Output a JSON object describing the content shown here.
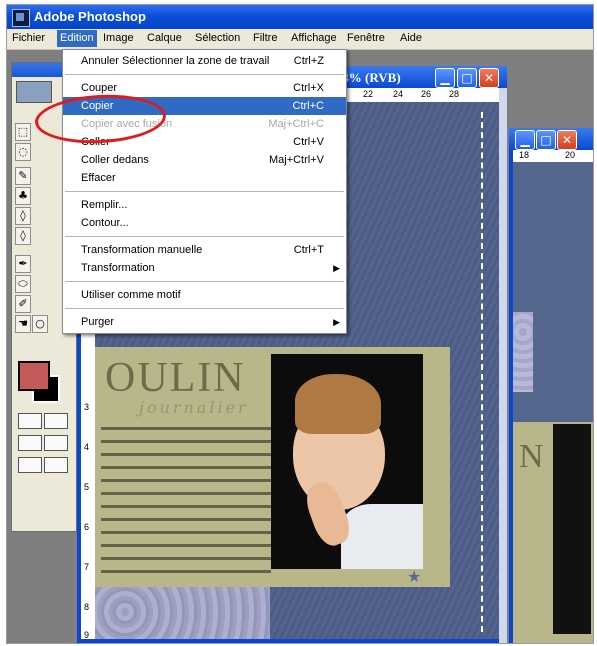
{
  "app": {
    "title": "Adobe Photoshop"
  },
  "menubar": {
    "items": [
      {
        "label": "Fichier"
      },
      {
        "label": "Edition"
      },
      {
        "label": "Image"
      },
      {
        "label": "Calque"
      },
      {
        "label": "Sélection"
      },
      {
        "label": "Filtre"
      },
      {
        "label": "Affichage"
      },
      {
        "label": "Fenêtre"
      },
      {
        "label": "Aide"
      }
    ]
  },
  "edit_menu": {
    "items": [
      {
        "label": "Annuler Sélectionner la zone de travail",
        "shortcut": "Ctrl+Z"
      },
      {
        "label": "Couper",
        "shortcut": "Ctrl+X"
      },
      {
        "label": "Copier",
        "shortcut": "Ctrl+C"
      },
      {
        "label": "Copier avec fusion",
        "shortcut": "Maj+Ctrl+C"
      },
      {
        "label": "Coller",
        "shortcut": "Ctrl+V"
      },
      {
        "label": "Coller dedans",
        "shortcut": "Maj+Ctrl+V"
      },
      {
        "label": "Effacer",
        "shortcut": ""
      },
      {
        "label": "Remplir...",
        "shortcut": ""
      },
      {
        "label": "Contour...",
        "shortcut": ""
      },
      {
        "label": "Transformation manuelle",
        "shortcut": "Ctrl+T"
      },
      {
        "label": "Transformation",
        "shortcut": ""
      },
      {
        "label": "Utiliser comme motif",
        "shortcut": ""
      },
      {
        "label": "Purger",
        "shortcut": ""
      }
    ]
  },
  "document": {
    "title": ".3% (RVB)",
    "ruler_numbers": [
      "22",
      "24",
      "26",
      "28"
    ],
    "ruler_left_numbers": [
      "3",
      "4",
      "5",
      "6",
      "7",
      "8",
      "9"
    ]
  },
  "document2": {
    "ruler_numbers": [
      "18",
      "20"
    ]
  },
  "canvas": {
    "big_title": "OULIN",
    "script_title": "journalier",
    "big_letter_2": "N"
  },
  "colors": {
    "foreground": "#c55a5a",
    "background": "#000000",
    "highlight": "#316ac5",
    "annotation": "#e11b1b"
  }
}
